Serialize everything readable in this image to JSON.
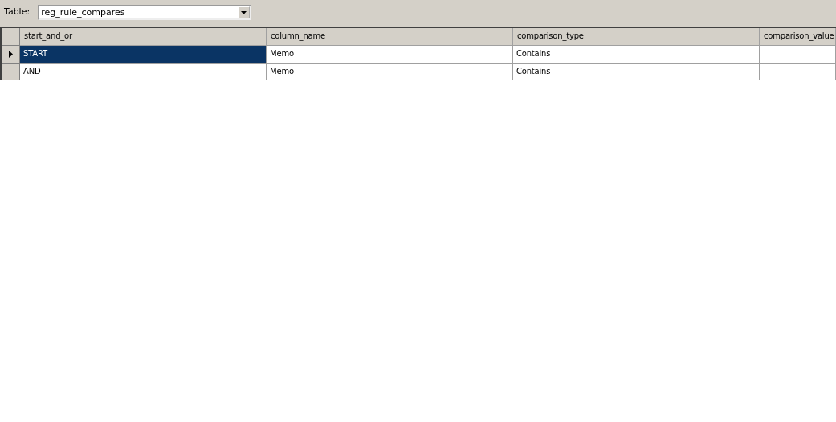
{
  "toolbar": {
    "label": "Table:",
    "table_select": {
      "value": "reg_rule_compares"
    }
  },
  "table": {
    "columns": [
      "start_and_or",
      "column_name",
      "comparison_type",
      "comparison_value"
    ],
    "rows": [
      {
        "selected": true,
        "cells": [
          "START",
          "Memo",
          "Contains",
          ""
        ]
      },
      {
        "selected": false,
        "cells": [
          "AND",
          "Memo",
          "Contains",
          ""
        ]
      }
    ]
  }
}
